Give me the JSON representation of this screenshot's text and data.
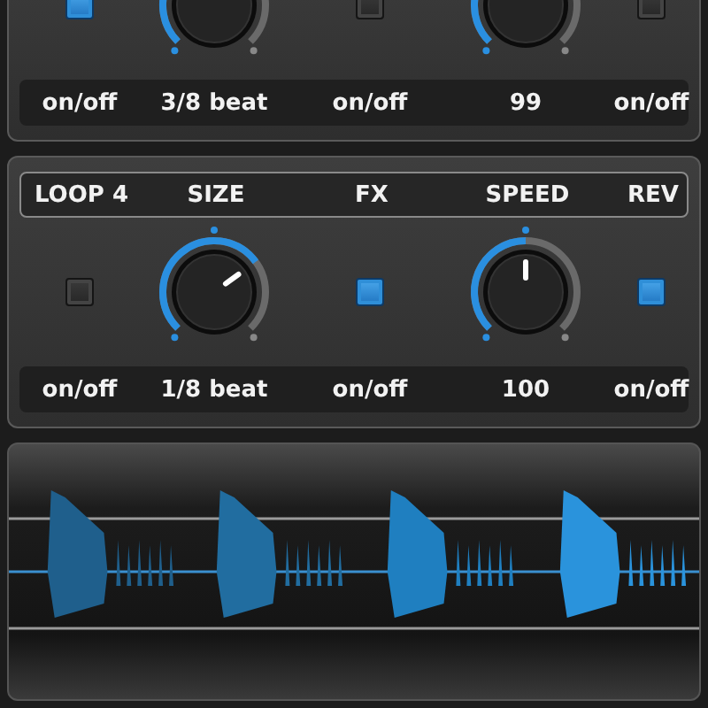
{
  "panels": [
    {
      "controls": [
        {
          "kind": "toggle",
          "on": true,
          "value": "on/off"
        },
        {
          "kind": "knob",
          "value": "3/8 beat"
        },
        {
          "kind": "toggle",
          "on": false,
          "value": "on/off"
        },
        {
          "kind": "knob",
          "value": "99"
        },
        {
          "kind": "toggle",
          "on": false,
          "value": "on/off"
        }
      ]
    },
    {
      "controls": [
        {
          "kind": "toggle",
          "label": "LOOP 4",
          "on": false,
          "value": "on/off"
        },
        {
          "kind": "knob",
          "label": "SIZE",
          "value": "1/8 beat"
        },
        {
          "kind": "toggle",
          "label": "FX",
          "on": true,
          "value": "on/off"
        },
        {
          "kind": "knob",
          "label": "SPEED",
          "value": "100"
        },
        {
          "kind": "toggle",
          "label": "REV",
          "on": true,
          "value": "on/off"
        }
      ]
    }
  ]
}
